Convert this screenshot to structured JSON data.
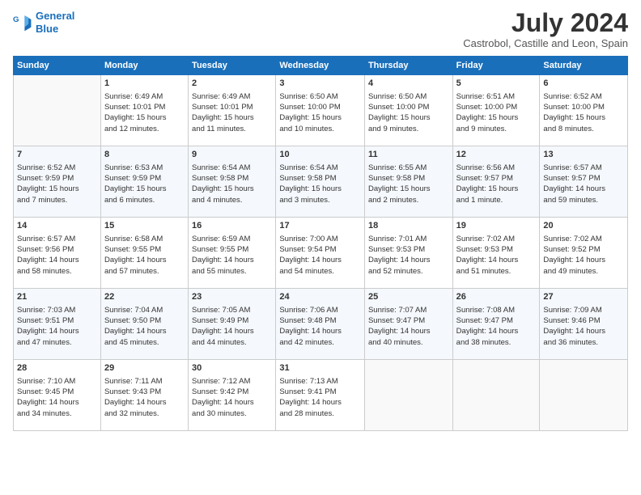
{
  "logo": {
    "line1": "General",
    "line2": "Blue"
  },
  "title": "July 2024",
  "location": "Castrobol, Castille and Leon, Spain",
  "days_header": [
    "Sunday",
    "Monday",
    "Tuesday",
    "Wednesday",
    "Thursday",
    "Friday",
    "Saturday"
  ],
  "weeks": [
    [
      {
        "day": "",
        "detail": ""
      },
      {
        "day": "1",
        "detail": "Sunrise: 6:49 AM\nSunset: 10:01 PM\nDaylight: 15 hours\nand 12 minutes."
      },
      {
        "day": "2",
        "detail": "Sunrise: 6:49 AM\nSunset: 10:01 PM\nDaylight: 15 hours\nand 11 minutes."
      },
      {
        "day": "3",
        "detail": "Sunrise: 6:50 AM\nSunset: 10:00 PM\nDaylight: 15 hours\nand 10 minutes."
      },
      {
        "day": "4",
        "detail": "Sunrise: 6:50 AM\nSunset: 10:00 PM\nDaylight: 15 hours\nand 9 minutes."
      },
      {
        "day": "5",
        "detail": "Sunrise: 6:51 AM\nSunset: 10:00 PM\nDaylight: 15 hours\nand 9 minutes."
      },
      {
        "day": "6",
        "detail": "Sunrise: 6:52 AM\nSunset: 10:00 PM\nDaylight: 15 hours\nand 8 minutes."
      }
    ],
    [
      {
        "day": "7",
        "detail": "Sunrise: 6:52 AM\nSunset: 9:59 PM\nDaylight: 15 hours\nand 7 minutes."
      },
      {
        "day": "8",
        "detail": "Sunrise: 6:53 AM\nSunset: 9:59 PM\nDaylight: 15 hours\nand 6 minutes."
      },
      {
        "day": "9",
        "detail": "Sunrise: 6:54 AM\nSunset: 9:58 PM\nDaylight: 15 hours\nand 4 minutes."
      },
      {
        "day": "10",
        "detail": "Sunrise: 6:54 AM\nSunset: 9:58 PM\nDaylight: 15 hours\nand 3 minutes."
      },
      {
        "day": "11",
        "detail": "Sunrise: 6:55 AM\nSunset: 9:58 PM\nDaylight: 15 hours\nand 2 minutes."
      },
      {
        "day": "12",
        "detail": "Sunrise: 6:56 AM\nSunset: 9:57 PM\nDaylight: 15 hours\nand 1 minute."
      },
      {
        "day": "13",
        "detail": "Sunrise: 6:57 AM\nSunset: 9:57 PM\nDaylight: 14 hours\nand 59 minutes."
      }
    ],
    [
      {
        "day": "14",
        "detail": "Sunrise: 6:57 AM\nSunset: 9:56 PM\nDaylight: 14 hours\nand 58 minutes."
      },
      {
        "day": "15",
        "detail": "Sunrise: 6:58 AM\nSunset: 9:55 PM\nDaylight: 14 hours\nand 57 minutes."
      },
      {
        "day": "16",
        "detail": "Sunrise: 6:59 AM\nSunset: 9:55 PM\nDaylight: 14 hours\nand 55 minutes."
      },
      {
        "day": "17",
        "detail": "Sunrise: 7:00 AM\nSunset: 9:54 PM\nDaylight: 14 hours\nand 54 minutes."
      },
      {
        "day": "18",
        "detail": "Sunrise: 7:01 AM\nSunset: 9:53 PM\nDaylight: 14 hours\nand 52 minutes."
      },
      {
        "day": "19",
        "detail": "Sunrise: 7:02 AM\nSunset: 9:53 PM\nDaylight: 14 hours\nand 51 minutes."
      },
      {
        "day": "20",
        "detail": "Sunrise: 7:02 AM\nSunset: 9:52 PM\nDaylight: 14 hours\nand 49 minutes."
      }
    ],
    [
      {
        "day": "21",
        "detail": "Sunrise: 7:03 AM\nSunset: 9:51 PM\nDaylight: 14 hours\nand 47 minutes."
      },
      {
        "day": "22",
        "detail": "Sunrise: 7:04 AM\nSunset: 9:50 PM\nDaylight: 14 hours\nand 45 minutes."
      },
      {
        "day": "23",
        "detail": "Sunrise: 7:05 AM\nSunset: 9:49 PM\nDaylight: 14 hours\nand 44 minutes."
      },
      {
        "day": "24",
        "detail": "Sunrise: 7:06 AM\nSunset: 9:48 PM\nDaylight: 14 hours\nand 42 minutes."
      },
      {
        "day": "25",
        "detail": "Sunrise: 7:07 AM\nSunset: 9:47 PM\nDaylight: 14 hours\nand 40 minutes."
      },
      {
        "day": "26",
        "detail": "Sunrise: 7:08 AM\nSunset: 9:47 PM\nDaylight: 14 hours\nand 38 minutes."
      },
      {
        "day": "27",
        "detail": "Sunrise: 7:09 AM\nSunset: 9:46 PM\nDaylight: 14 hours\nand 36 minutes."
      }
    ],
    [
      {
        "day": "28",
        "detail": "Sunrise: 7:10 AM\nSunset: 9:45 PM\nDaylight: 14 hours\nand 34 minutes."
      },
      {
        "day": "29",
        "detail": "Sunrise: 7:11 AM\nSunset: 9:43 PM\nDaylight: 14 hours\nand 32 minutes."
      },
      {
        "day": "30",
        "detail": "Sunrise: 7:12 AM\nSunset: 9:42 PM\nDaylight: 14 hours\nand 30 minutes."
      },
      {
        "day": "31",
        "detail": "Sunrise: 7:13 AM\nSunset: 9:41 PM\nDaylight: 14 hours\nand 28 minutes."
      },
      {
        "day": "",
        "detail": ""
      },
      {
        "day": "",
        "detail": ""
      },
      {
        "day": "",
        "detail": ""
      }
    ]
  ]
}
